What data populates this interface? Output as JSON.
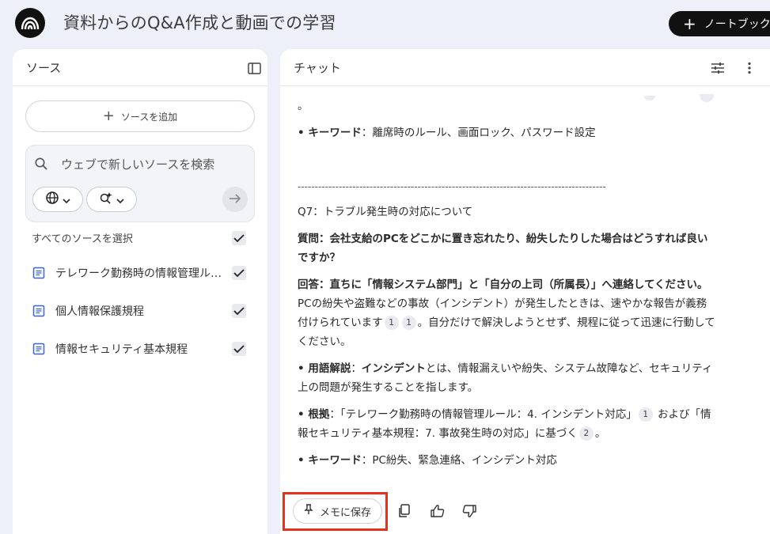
{
  "app": {
    "title": "資料からのQ&A作成と動画での学習",
    "new_notebook_label": "ノートブックを"
  },
  "sources": {
    "header": "ソース",
    "add_source_label": "ソースを追加",
    "search_placeholder": "ウェブで新しいソースを検索",
    "select_all_label": "すべてのソースを選択",
    "items": [
      {
        "label": "テレワーク勤務時の情報管理ルール",
        "checked": true
      },
      {
        "label": "個人情報保護規程",
        "checked": true
      },
      {
        "label": "情報セキュリティ基本規程",
        "checked": true
      }
    ]
  },
  "chat": {
    "header": "チャット",
    "top_fragment": "。",
    "kw1_label": "• キーワード",
    "kw1_text": "：離席時のルール、画面ロック、パスワード設定",
    "separator": "------------------------------------------------------------------------------------------",
    "q7_title": "Q7：トラブル発生時の対応について",
    "question_label": "質問",
    "question_text": "：会社支給のPCをどこかに置き忘れたり、紛失したりした場合はどうすれば良いですか？",
    "answer_label": "回答",
    "answer_bold": "：直ちに「情報システム部門」と「自分の上司（所属長）」へ連絡してください。",
    "answer_text_1": " PCの紛失や盗難などの事故（インシデント）が発生したときは、速やかな報告が義務付けられています",
    "cite_a": "1",
    "cite_b": "1",
    "answer_text_2": "。自分だけで解決しようとせず、規程に従って迅速に行動してください。",
    "term_label": "• 用語解説",
    "term_colon": "：",
    "term_bold": "インシデント",
    "term_text": "とは、情報漏えいや紛失、システム故障など、セキュリティ上の問題が発生することを指します。",
    "basis_label": "• 根拠",
    "basis_text_1": "：「テレワーク勤務時の情報管理ルール：4. インシデント対応」",
    "cite_c": "1",
    "basis_text_2": " および「情報セキュリティ基本規程：7. 事故発生時の対応」に基づく",
    "cite_d": "2",
    "basis_text_3": "。",
    "kw2_label": "• キーワード",
    "kw2_text": "：PC紛失、緊急連絡、インシデント対応",
    "save_note_label": "メモに保存"
  },
  "colors": {
    "background": "#eef0f9",
    "highlight": "#e8321e",
    "dark_button": "#111111"
  }
}
